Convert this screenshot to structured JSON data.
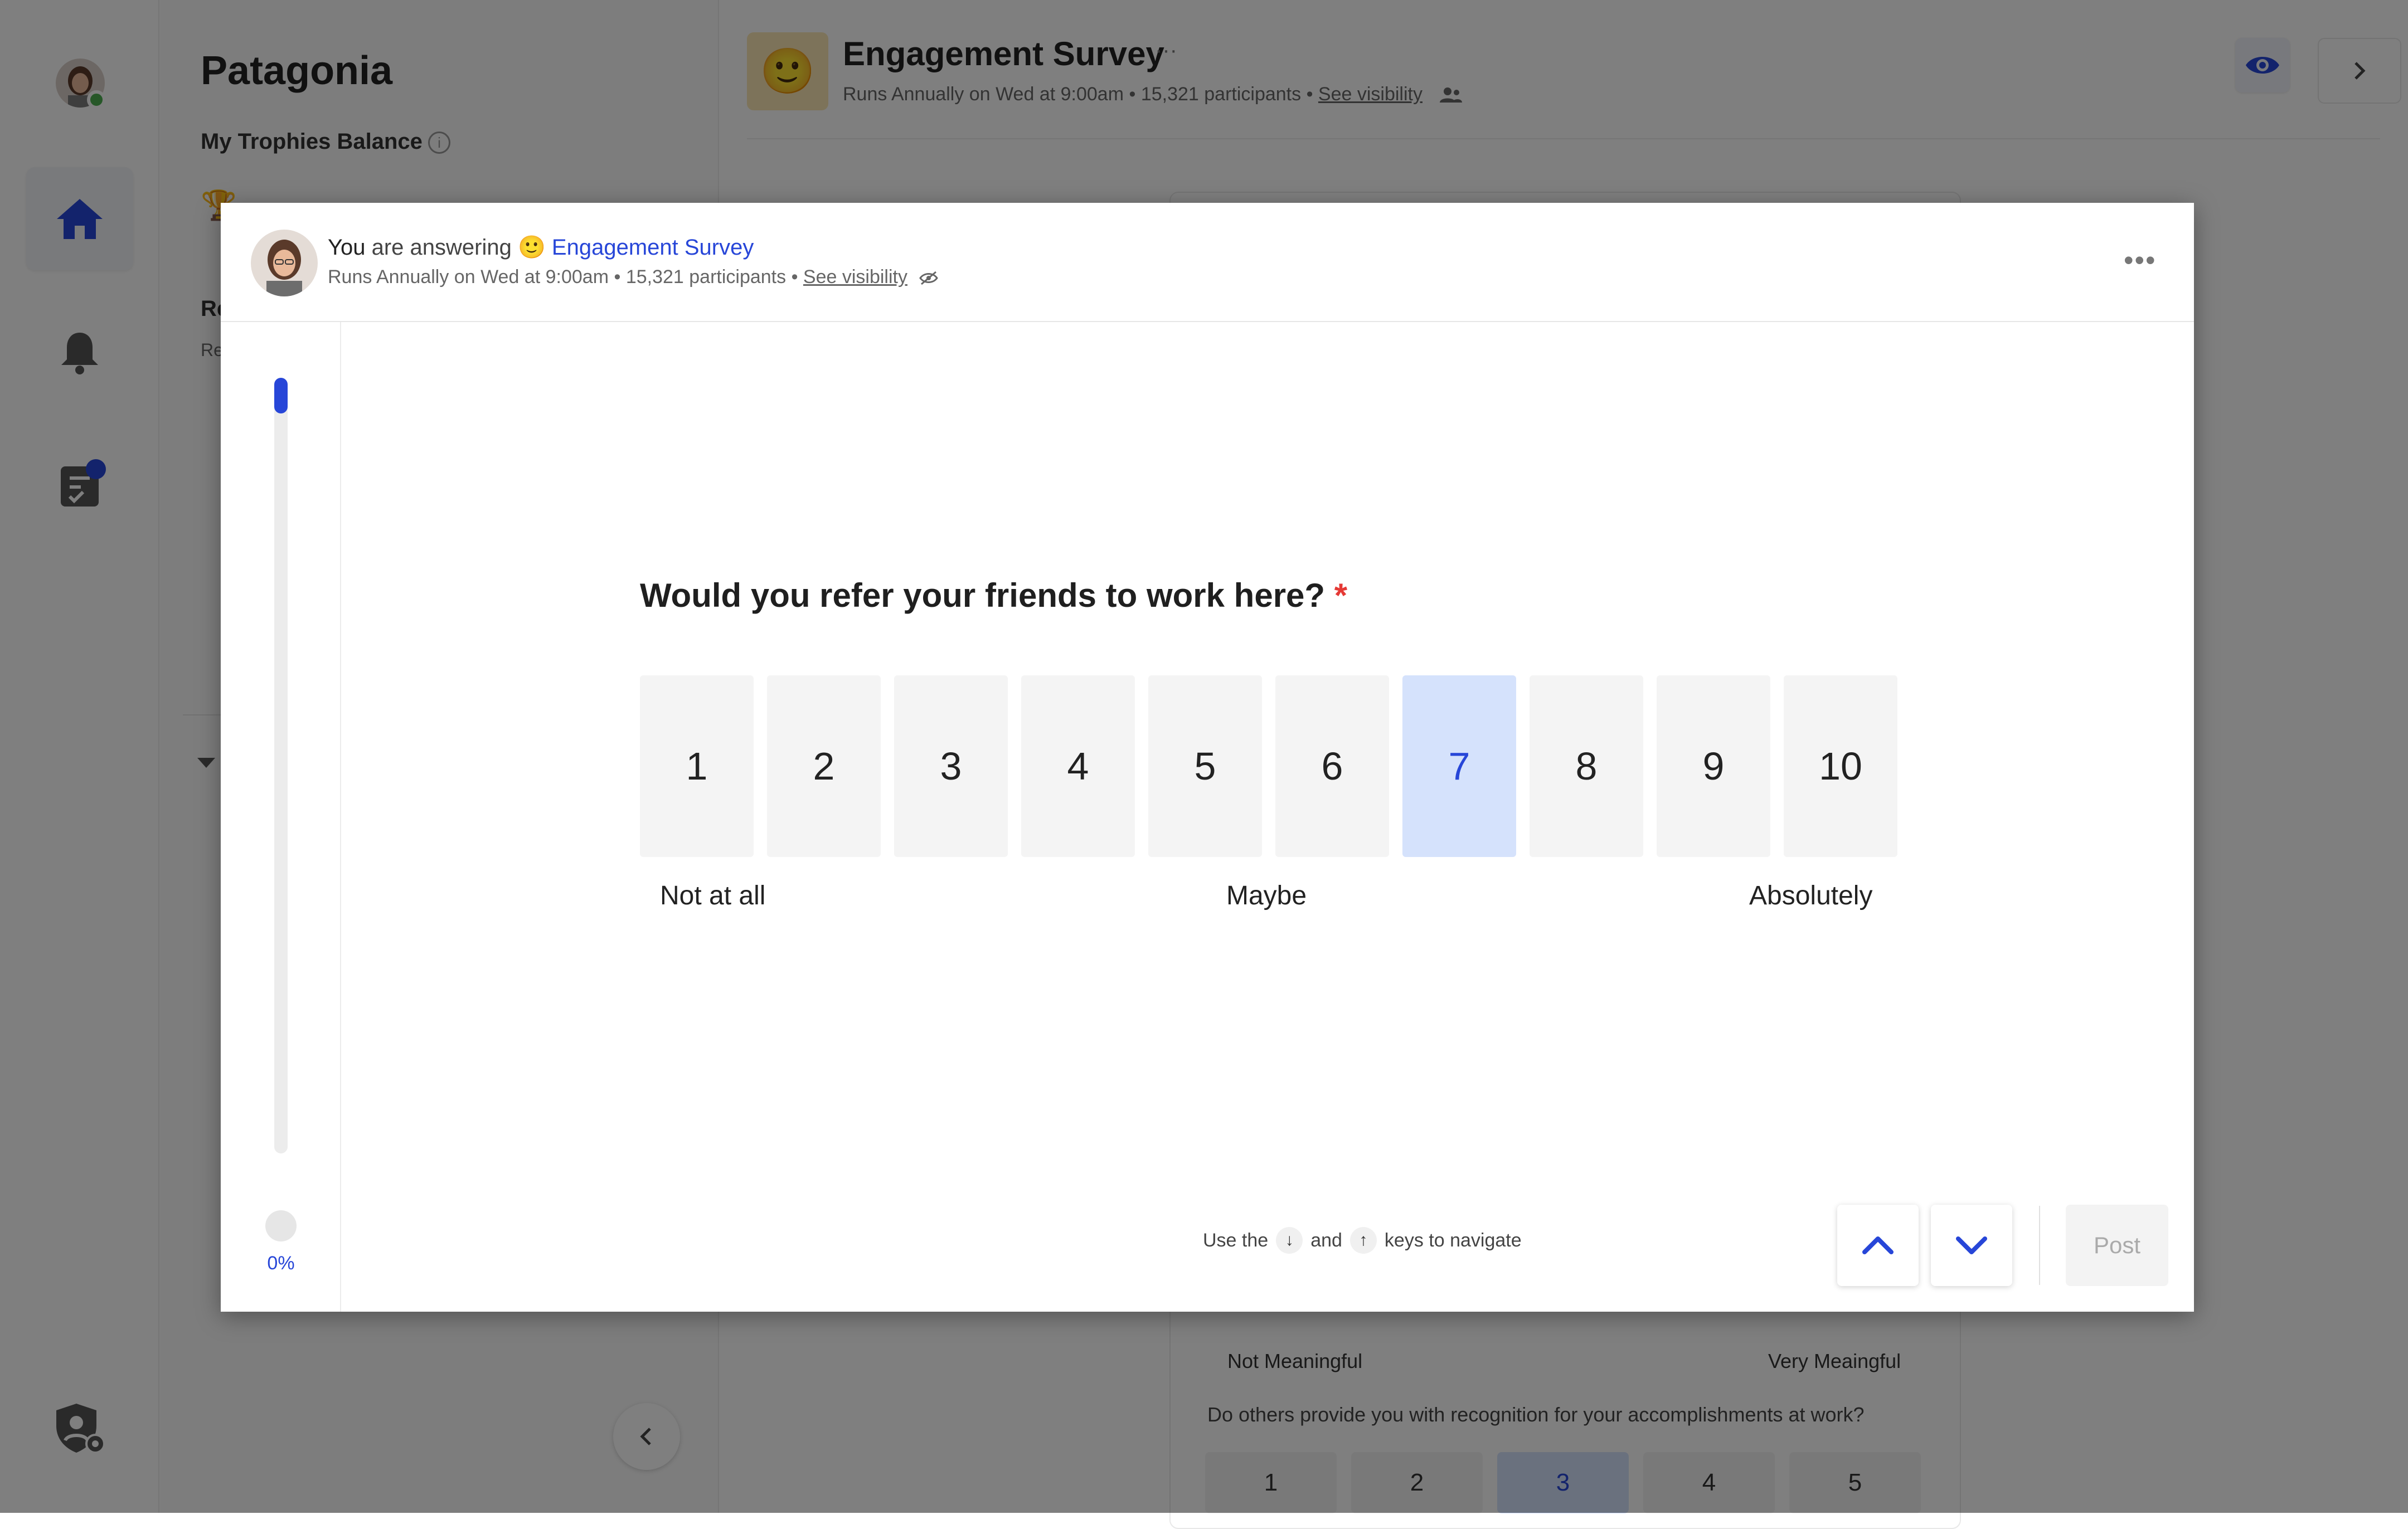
{
  "app": {
    "org_name": "Patagonia"
  },
  "sidebar_panel": {
    "trophies_title": "My Trophies Balance",
    "trophies_value": "🏆",
    "section_r": "Re",
    "section_r_sub": "Re"
  },
  "survey_header": {
    "emoji": "🙂",
    "title": "Engagement Survey",
    "more": "···",
    "meta_prefix": "Runs Annually on Wed at 9:00am • 15,321 participants • ",
    "visibility_link": "See visibility"
  },
  "background_card": {
    "meaning_left": "Not Meaningful",
    "meaning_right": "Very Meaingful",
    "question2": "Do others provide you with recognition for your accomplishments at work?",
    "scale2": [
      "1",
      "2",
      "3",
      "4",
      "5"
    ],
    "scale2_selected": "3"
  },
  "modal": {
    "header": {
      "you": "You",
      "answering": " are answering ",
      "emoji": "🙂",
      "survey_link": "Engagement Survey",
      "meta_prefix": "Runs Annually on Wed at 9:00am • 15,321 participants • ",
      "visibility_link": "See visibility",
      "more": "•••"
    },
    "progress": {
      "percent_label": "0%",
      "fraction": 0.0
    },
    "question": {
      "text": "Would you refer your friends to work here?",
      "required_mark": "*"
    },
    "scale": {
      "options": [
        "1",
        "2",
        "3",
        "4",
        "5",
        "6",
        "7",
        "8",
        "9",
        "10"
      ],
      "selected": "7",
      "label_low": "Not at all",
      "label_mid": "Maybe",
      "label_high": "Absolutely"
    },
    "footer": {
      "hint_use": "Use the",
      "hint_key_down": "↓",
      "hint_and": "and",
      "hint_key_up": "↑",
      "hint_tail": "keys to navigate",
      "post_label": "Post"
    }
  },
  "colors": {
    "accent": "#2746d8",
    "selected_bg": "#d5e2fc",
    "required": "#e53935",
    "online": "#4caf50"
  }
}
